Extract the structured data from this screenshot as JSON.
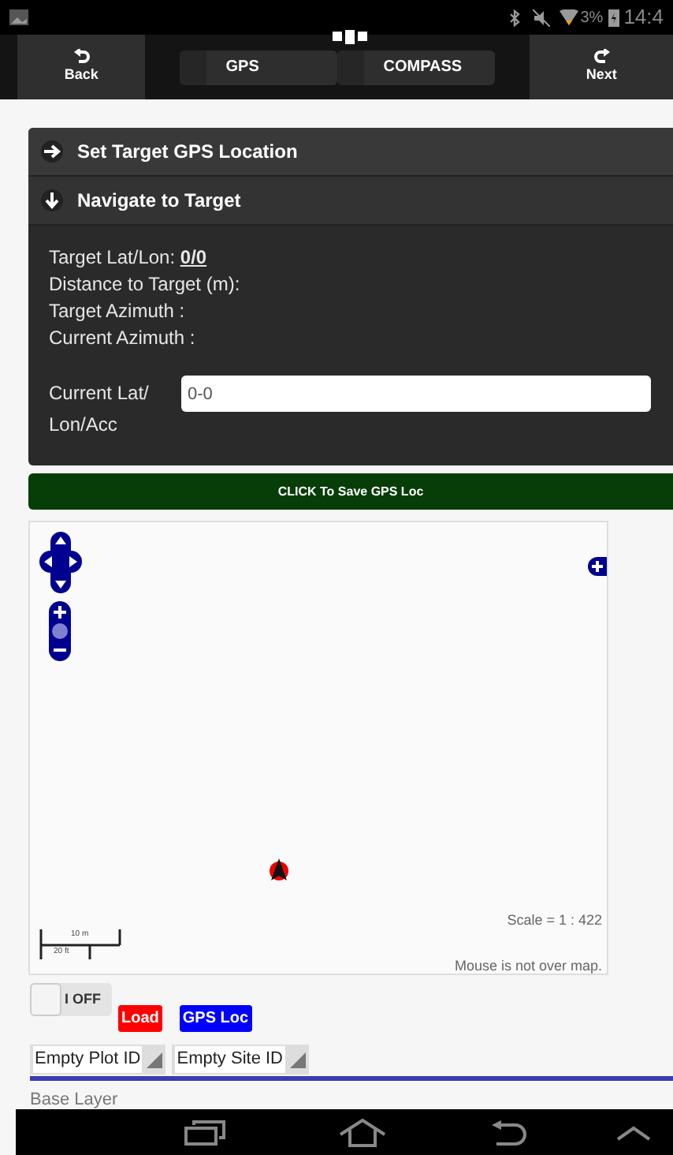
{
  "status_bar": {
    "battery": "3%",
    "time": "14:4"
  },
  "header": {
    "back": "Back",
    "next": "Next",
    "tabs": [
      {
        "label": "GPS",
        "selected": false
      },
      {
        "label": "COMPASS",
        "selected": false
      }
    ]
  },
  "sections": [
    {
      "title": "Set Target GPS Location",
      "expanded": false
    },
    {
      "title": "Navigate to Target",
      "expanded": true
    }
  ],
  "navigate": {
    "lines": [
      "Target Lat/Lon: **0/0**",
      "Distance to Target (m):",
      "Target Azimuth :",
      "Current Azimuth :"
    ],
    "field_label": "Current Lat/ Lon/Acc",
    "field_value": "0-0"
  },
  "save_button": "CLICK To Save GPS Loc",
  "map": {
    "scale": "Scale = 1 : 422",
    "scale_metric": "10 m",
    "scale_imperial": "20 ft",
    "mouse": "Mouse is not over map."
  },
  "toggle": {
    "label": "I OFF",
    "on": false
  },
  "buttons": [
    {
      "label": "Load",
      "color": "#ff0000"
    },
    {
      "label": "GPS Loc",
      "color": "#0000ff"
    }
  ],
  "selects": [
    "Empty Plot ID",
    "Empty Site ID"
  ],
  "layers_title": "Base Layer"
}
